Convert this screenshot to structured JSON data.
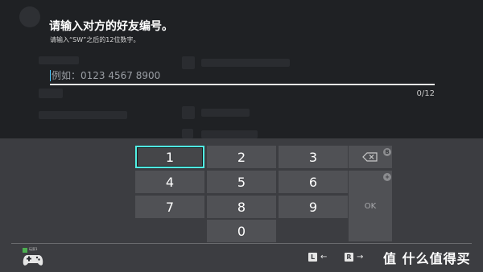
{
  "dialog": {
    "title": "请输入对方的好友编号。",
    "subtitle": "请输入“SW”之后的12位数字。",
    "input_placeholder": "例如：0123 4567 8900",
    "input_value": "",
    "char_counter": "0/12"
  },
  "keypad": {
    "keys": [
      "1",
      "2",
      "3",
      "4",
      "5",
      "6",
      "7",
      "8",
      "9",
      "0"
    ],
    "selected_key": "1",
    "ok_label": "OK",
    "backspace_hint": "B",
    "ok_hint": "+"
  },
  "footer": {
    "controller_label": "玩家1",
    "hints": [
      {
        "button": "L",
        "arrow": "←"
      },
      {
        "button": "R",
        "arrow": "→"
      }
    ],
    "watermark": "值 什么值得买"
  },
  "colors": {
    "selection_border": "#4ff0e3",
    "key_bg": "#505155",
    "panel_bg": "#3c3d41",
    "caret": "#4ec9ff"
  }
}
